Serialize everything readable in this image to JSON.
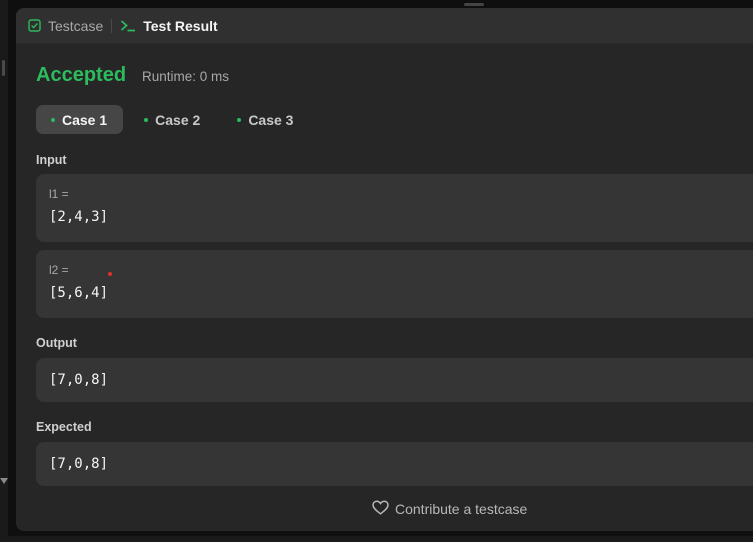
{
  "tabs": {
    "testcase_label": "Testcase",
    "result_label": "Test Result"
  },
  "result": {
    "status": "Accepted",
    "runtime": "Runtime: 0 ms"
  },
  "cases": [
    {
      "label": "Case 1",
      "active": true
    },
    {
      "label": "Case 2",
      "active": false
    },
    {
      "label": "Case 3",
      "active": false
    }
  ],
  "input": {
    "label": "Input",
    "params": [
      {
        "name": "l1 =",
        "value": "[2,4,3]"
      },
      {
        "name": "l2 =",
        "value": "[5,6,4]"
      }
    ]
  },
  "output": {
    "label": "Output",
    "value": "[7,0,8]"
  },
  "expected": {
    "label": "Expected",
    "value": "[7,0,8]"
  },
  "footer": {
    "contribute_label": "Contribute a testcase"
  },
  "colors": {
    "accent_green": "#2cbb5d",
    "panel_bg": "#262626",
    "box_bg": "#353535"
  },
  "icons": [
    "checkbox-icon",
    "terminal-icon",
    "heart-icon"
  ]
}
